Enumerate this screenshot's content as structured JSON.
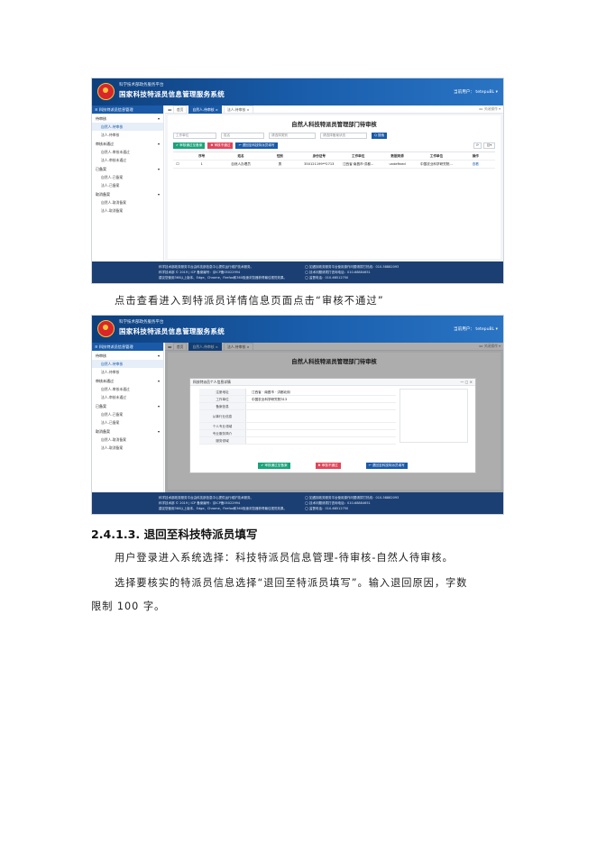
{
  "app": {
    "subtitle": "科学技术部政务服务平台",
    "title": "国家科技特派员信息管理服务系统",
    "user1": "当前用户：  tetepuBL ▾",
    "user2": "当前用户：  tetepuBL ▾"
  },
  "sidebar": {
    "header": "≡ 科技特派员信息管理",
    "groups": [
      {
        "label": "待审核",
        "items": [
          "自然人-待审核",
          "法人-待审核"
        ]
      },
      {
        "label": "审核未通过",
        "items": [
          "自然人-审核未通过",
          "法人-审核未通过"
        ]
      },
      {
        "label": "已备案",
        "items": [
          "自然人-已备案",
          "法人-已备案"
        ]
      },
      {
        "label": "取消备案",
        "items": [
          "自然人-取消备案",
          "法人-取消备案"
        ]
      }
    ]
  },
  "tabs": {
    "nav": "◂◂",
    "home": "首页",
    "tab1": "自然人-待审核 ×",
    "tab2": "法人-待审核 ×",
    "right": "▸▸  关闭操作 ▾"
  },
  "panel": {
    "title": "自然人科技特派员管理部门待审核",
    "filters": [
      "工作单位",
      "姓名",
      "请选择类别",
      "请选择备案状态"
    ],
    "search_button": "Q 搜索",
    "buttons": {
      "approve": "✔ 审核通过至备案",
      "reject": "✖ 审核不通过",
      "return": "↩ 退回至科技特派员填写"
    },
    "tools": [
      "⟳",
      "目▾"
    ],
    "table": {
      "headers": [
        "",
        "序号",
        "姓名",
        "性别",
        "身份证号",
        "工作单位",
        "数据来源",
        "工作单位",
        "操作"
      ],
      "row": [
        "☐",
        "1",
        "自然人办理员",
        "男",
        "350121199**2713",
        "江西省·南昌市·洪都...",
        "undefined",
        "中国农业科学研究院...",
        "查看"
      ]
    }
  },
  "footer": {
    "left": [
      "科学技术部政务服务平台由科技部信息中心提供运行维护技术服务。",
      "科学技术部 © 2019 | ICP 备案编号：京ICP备05022994",
      "建议您使用360以上版本、Edge、Chrome、Firefox和360极速浏览器获得最佳视觉效果。"
    ],
    "right": [
      "◯ 如遇到政务服务平台使用操作问题请拨打热线：010-58882093",
      "◯ 技术问题请拨打咨询电话：010-68884651",
      "◯ 监督电话：010-68512750"
    ]
  },
  "modal": {
    "title": "科技特派员个人信息详情",
    "controls": "— ▢ ×",
    "rows": [
      {
        "k": "注册地址",
        "v": "江西省 · 南昌市 · 洪都北街"
      },
      {
        "k": "工作单位",
        "v": "中国农业科学研究院313"
      },
      {
        "k": "备案信息",
        "v": ""
      },
      {
        "k": "从事行业信息",
        "v": ""
      },
      {
        "k": "个人专业领域",
        "v": ""
      },
      {
        "k": "专业服务简介",
        "v": ""
      },
      {
        "k": "服务领域",
        "v": ""
      }
    ],
    "buttons": {
      "approve": "✔ 审核通过至备案",
      "reject": "✖ 审核不通过",
      "return": "↩ 退回至科技特派员填写"
    }
  },
  "doc": {
    "caption": "点击查看进入到特派员详情信息页面点击“审核不通过”",
    "section": "2.4.1.3.  退回至科技特派员填写",
    "p1": "用户登录进入系统选择：科技特派员信息管理-待审核-自然人待审核。",
    "p2": "选择要核实的特派员信息选择“退回至特派员填写”。输入退回原因，字数",
    "p3": "限制 100 字。"
  }
}
